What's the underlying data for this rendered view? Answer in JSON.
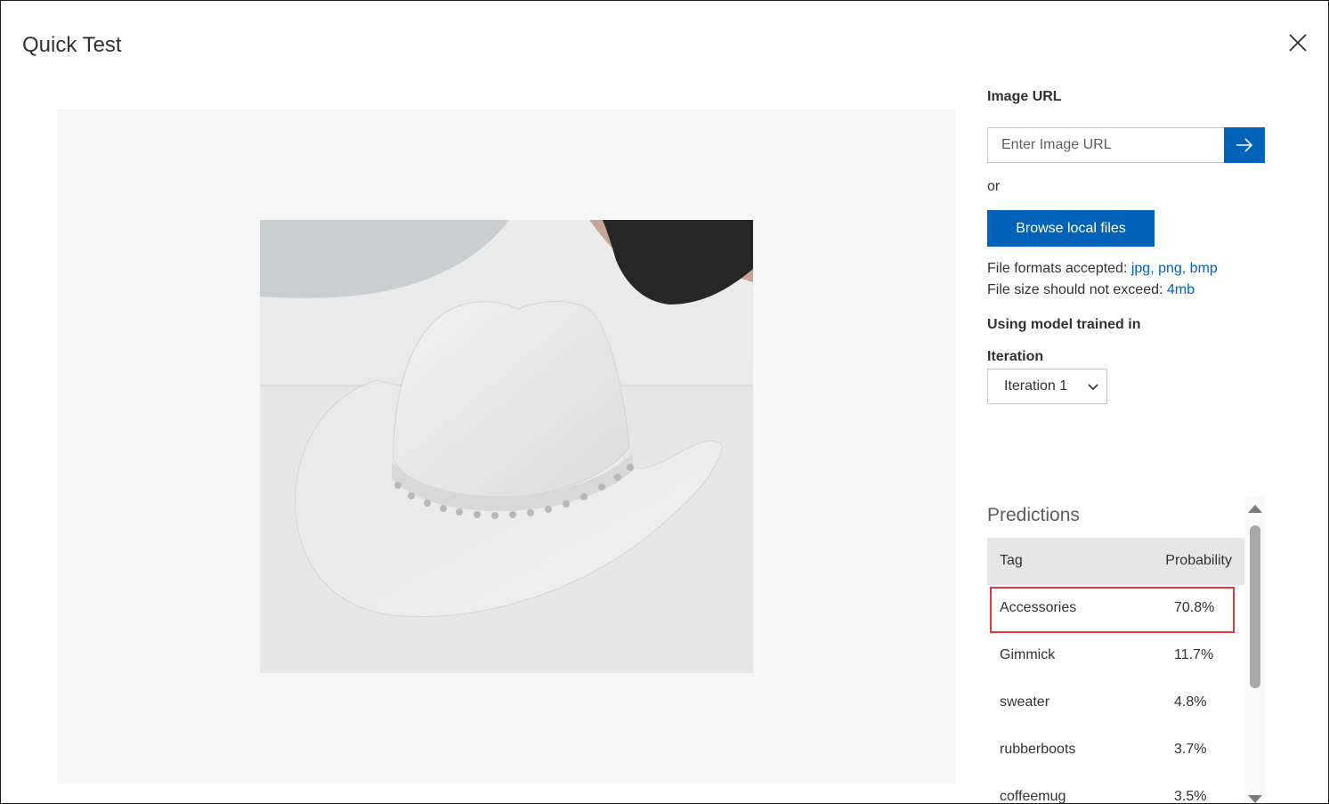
{
  "dialog": {
    "title": "Quick Test"
  },
  "image_url": {
    "label": "Image URL",
    "placeholder": "Enter Image URL",
    "value": ""
  },
  "or_text": "or",
  "browse_label": "Browse local files",
  "file_info": {
    "formats_label": "File formats accepted: ",
    "formats": [
      "jpg",
      "png",
      "bmp"
    ],
    "formats_text": "jpg, png, bmp",
    "size_label": "File size should not exceed: ",
    "size_value": "4mb"
  },
  "model": {
    "using_label": "Using model trained in",
    "iteration_label": "Iteration",
    "iteration_value": "Iteration 1"
  },
  "predictions": {
    "title": "Predictions",
    "headers": {
      "tag": "Tag",
      "probability": "Probability"
    },
    "rows": [
      {
        "tag": "Accessories",
        "probability": "70.8%"
      },
      {
        "tag": "Gimmick",
        "probability": "11.7%"
      },
      {
        "tag": "sweater",
        "probability": "4.8%"
      },
      {
        "tag": "rubberboots",
        "probability": "3.7%"
      },
      {
        "tag": "coffeemug",
        "probability": "3.5%"
      }
    ]
  },
  "colors": {
    "accent": "#0062b8",
    "highlight": "#e03a3a",
    "header_bg": "#e6e6e6",
    "preview_bg": "#f6f6f6"
  },
  "icons": {
    "close": "close-icon",
    "submit": "arrow-right-icon",
    "dropdown": "chevron-down-icon"
  }
}
